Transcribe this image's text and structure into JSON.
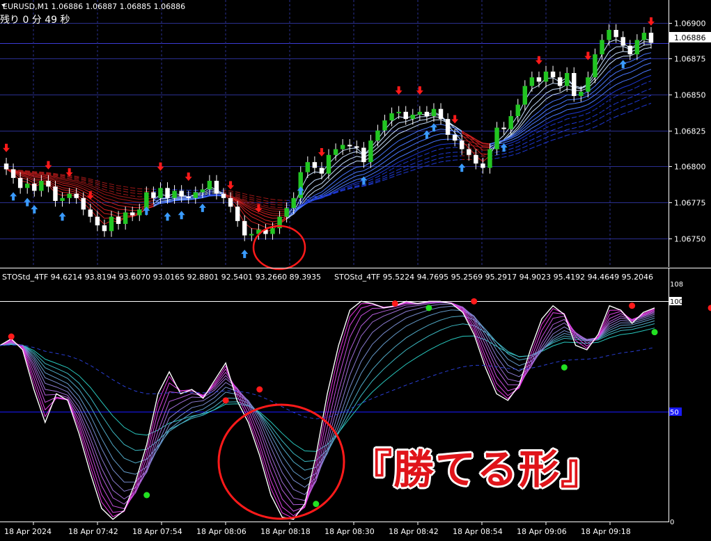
{
  "header": {
    "symbol_line": "EURUSD,M1  1.06886 1.06887 1.06885 1.06886",
    "timer_text": "残り 0 分 49 秒"
  },
  "caption": "『勝てる形』",
  "colors": {
    "background": "#000000",
    "grid": "#2a2f8f",
    "axis": "#ffffff",
    "bull_body": "#22c522",
    "bear_body": "#ffffff",
    "up_arrow": "#3a9bff",
    "down_arrow": "#ff1a1a",
    "highlight_circle": "#ff1a1a",
    "level_line": "#1a1aff",
    "caption": "#e0141a"
  },
  "chart_data": [
    {
      "type": "candlestick",
      "title": "EURUSD,M1",
      "ohlc_readout": {
        "open": 1.06886,
        "high": 1.06887,
        "low": 1.06885,
        "close": 1.06886
      },
      "ylim": [
        1.0673,
        1.0691
      ],
      "y_ticks": [
        "1.06900",
        "1.06875",
        "1.06850",
        "1.06825",
        "1.06800",
        "1.06775",
        "1.06750"
      ],
      "y_tick_values": [
        1.069,
        1.06875,
        1.0685,
        1.06825,
        1.068,
        1.06775,
        1.0675
      ],
      "current_price_label": "1.06886",
      "current_price": 1.06886,
      "grid": true,
      "series": [
        {
          "name": "price",
          "close": [
            1.06798,
            1.06792,
            1.06785,
            1.06788,
            1.06783,
            1.0679,
            1.06786,
            1.06776,
            1.06778,
            1.06781,
            1.06778,
            1.0677,
            1.06765,
            1.06759,
            1.06755,
            1.06765,
            1.0676,
            1.06768,
            1.06766,
            1.0677,
            1.06782,
            1.06778,
            1.06785,
            1.06778,
            1.06783,
            1.06779,
            1.06778,
            1.06782,
            1.06784,
            1.0679,
            1.06781,
            1.06778,
            1.06772,
            1.06762,
            1.06752,
            1.06753,
            1.06756,
            1.06753,
            1.06757,
            1.06765,
            1.06771,
            1.06778,
            1.06796,
            1.06803,
            1.06799,
            1.06795,
            1.06808,
            1.06812,
            1.06815,
            1.06814,
            1.06813,
            1.06803,
            1.06818,
            1.06825,
            1.06832,
            1.06837,
            1.06838,
            1.06833,
            1.06836,
            1.06838,
            1.06835,
            1.0684,
            1.06833,
            1.06822,
            1.06818,
            1.06812,
            1.06808,
            1.06802,
            1.06799,
            1.06812,
            1.06827,
            1.06826,
            1.06835,
            1.06843,
            1.06856,
            1.06862,
            1.06859,
            1.06866,
            1.06862,
            1.06856,
            1.06865,
            1.06849,
            1.06852,
            1.06862,
            1.06878,
            1.06888,
            1.06895,
            1.0689,
            1.06884,
            1.06878,
            1.06888,
            1.06893,
            1.06886
          ]
        }
      ],
      "signals": [
        {
          "type": "buy",
          "x_index": 1
        },
        {
          "type": "sell",
          "x_index": 0
        },
        {
          "type": "buy",
          "x_index": 3
        },
        {
          "type": "buy",
          "x_index": 4
        },
        {
          "type": "buy",
          "x_index": 8
        },
        {
          "type": "sell",
          "x_index": 6
        },
        {
          "type": "sell",
          "x_index": 9
        },
        {
          "type": "sell",
          "x_index": 12
        },
        {
          "type": "buy",
          "x_index": 20
        },
        {
          "type": "buy",
          "x_index": 23
        },
        {
          "type": "buy",
          "x_index": 25
        },
        {
          "type": "sell",
          "x_index": 22
        },
        {
          "type": "buy",
          "x_index": 28
        },
        {
          "type": "sell",
          "x_index": 26
        },
        {
          "type": "buy",
          "x_index": 34
        },
        {
          "type": "sell",
          "x_index": 32
        },
        {
          "type": "sell",
          "x_index": 36
        },
        {
          "type": "buy",
          "x_index": 42
        },
        {
          "type": "sell",
          "x_index": 45
        },
        {
          "type": "buy",
          "x_index": 51
        },
        {
          "type": "buy",
          "x_index": 60
        },
        {
          "type": "buy",
          "x_index": 61
        },
        {
          "type": "buy",
          "x_index": 65
        },
        {
          "type": "sell",
          "x_index": 56
        },
        {
          "type": "sell",
          "x_index": 59
        },
        {
          "type": "sell",
          "x_index": 64
        },
        {
          "type": "buy",
          "x_index": 71
        },
        {
          "type": "sell",
          "x_index": 76
        },
        {
          "type": "sell",
          "x_index": 83
        },
        {
          "type": "buy",
          "x_index": 88
        },
        {
          "type": "sell",
          "x_index": 92
        }
      ]
    },
    {
      "type": "line",
      "title": "STOStd_4TF",
      "legend_line_1": "STOStd_4TF 94.6214 93.8194 93.6070 93.0165 92.8801 92.5401 93.2660 89.3935",
      "legend_line_2": "STOStd_4TF 95.5224 94.7695 95.2569 95.2917 94.9023 95.4192 94.4649 95.2046",
      "legend_values_1": [
        94.6214,
        93.8194,
        93.607,
        93.0165,
        92.8801,
        92.5401,
        93.266,
        89.3935
      ],
      "legend_values_2": [
        95.5224,
        94.7695,
        95.2569,
        95.2917,
        94.9023,
        95.4192,
        94.4649,
        95.2046
      ],
      "ylim": [
        0,
        108
      ],
      "y_ticks": [
        "108",
        "100",
        "50",
        "0"
      ],
      "level_lines": [
        100,
        50,
        0
      ],
      "grid": false,
      "main_line": [
        80,
        83,
        78,
        60,
        45,
        58,
        55,
        40,
        22,
        6,
        1,
        5,
        18,
        35,
        58,
        68,
        58,
        60,
        56,
        64,
        72,
        55,
        45,
        30,
        12,
        2,
        1,
        8,
        30,
        58,
        80,
        96,
        100,
        99,
        97,
        98,
        100,
        99,
        100,
        100,
        99,
        95,
        85,
        70,
        58,
        55,
        62,
        78,
        92,
        98,
        94,
        80,
        78,
        85,
        98,
        96,
        90,
        95,
        97
      ],
      "dots": [
        {
          "color": "red",
          "x_index": 1,
          "y": 84
        },
        {
          "color": "green",
          "x_index": 13,
          "y": 12
        },
        {
          "color": "red",
          "x_index": 20,
          "y": 55
        },
        {
          "color": "red",
          "x_index": 23,
          "y": 60
        },
        {
          "color": "green",
          "x_index": 28,
          "y": 8
        },
        {
          "color": "red",
          "x_index": 35,
          "y": 99
        },
        {
          "color": "green",
          "x_index": 38,
          "y": 97
        },
        {
          "color": "red",
          "x_index": 42,
          "y": 100
        },
        {
          "color": "green",
          "x_index": 50,
          "y": 70
        },
        {
          "color": "red",
          "x_index": 56,
          "y": 98
        },
        {
          "color": "green",
          "x_index": 58,
          "y": 86
        },
        {
          "color": "red",
          "x_index": 63,
          "y": 97
        }
      ]
    }
  ],
  "x_axis": {
    "labels": [
      "18 Apr 2024",
      "18 Apr 07:42",
      "18 Apr 07:54",
      "18 Apr 08:06",
      "18 Apr 08:18",
      "18 Apr 08:30",
      "18 Apr 08:42",
      "18 Apr 08:54",
      "18 Apr 09:06",
      "18 Apr 09:18"
    ]
  }
}
